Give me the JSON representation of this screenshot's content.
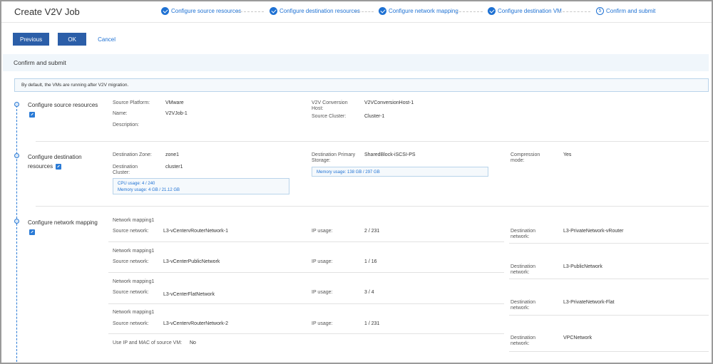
{
  "header": {
    "title": "Create V2V Job",
    "steps": [
      {
        "label": "Configure source resources"
      },
      {
        "label": "Configure destination resources"
      },
      {
        "label": "Configure network mapping"
      },
      {
        "label": "Configure destination VM"
      },
      {
        "label": "Confirm and submit",
        "number": "5"
      }
    ]
  },
  "actions": {
    "previous": "Previous",
    "ok": "OK",
    "cancel": "Cancel"
  },
  "section": {
    "title": "Confirm and submit"
  },
  "info": "By default, the VMs are running after V2V migration.",
  "source": {
    "title": "Configure source resources",
    "platform_label": "Source Platform:",
    "platform": "VMware",
    "name_label": "Name:",
    "name": "V2VJob-1",
    "desc_label": "Description:",
    "host_label": "V2V Conversion Host:",
    "host": "V2VConversionHost-1",
    "cluster_label": "Source Cluster:",
    "cluster": "Cluster-1"
  },
  "destination": {
    "title": "Configure destination resources",
    "zone_label": "Destination Zone:",
    "zone": "zone1",
    "cluster_label": "Destination Cluster:",
    "cluster": "cluster1",
    "cpu_usage": "CPU usage:  4 / 240",
    "mem_usage": "Memory usage:  4 GB / 21.12 GB",
    "storage_label": "Destination Primary Storage:",
    "storage": "SharedBlock-iSCSI-PS",
    "storage_usage": "Memory usage:  138 GB / 297 GB",
    "compression_label": "Compression mode:",
    "compression": "Yes"
  },
  "network": {
    "title": "Configure network mapping",
    "mappings": [
      {
        "heading": "Network mapping1",
        "src_label": "Source network:",
        "src": "L3-vCentervRouterNetwork-1",
        "ip_label": "IP usage:",
        "ip": "2 / 231",
        "dst_label": "Destination network:",
        "dst": "L3-PrivateNetwork-vRouter"
      },
      {
        "heading": "Network mapping1",
        "src_label": "Source network:",
        "src": "L3-vCenterPublicNetwork",
        "ip_label": "IP usage:",
        "ip": "1 / 16",
        "dst_label": "Destination network:",
        "dst": "L3-PublicNetwork"
      },
      {
        "heading": "Network mapping1",
        "src_label": "Source network:",
        "src": "L3-vCenterFlatNetwork",
        "ip_label": "IP usage:",
        "ip": "3 / 4",
        "dst_label": "Destination network:",
        "dst": "L3-PrivateNetwork-Flat"
      },
      {
        "heading": "Network mapping1",
        "src_label": "Source network:",
        "src": "L3-vCentervRouterNetwork-2",
        "ip_label": "IP usage:",
        "ip": "1 / 231",
        "dst_label": "Destination network:",
        "dst": "VPCNetwork"
      }
    ],
    "use_ip_mac_label": "Use IP and MAC of source VM:",
    "use_ip_mac": "No"
  }
}
